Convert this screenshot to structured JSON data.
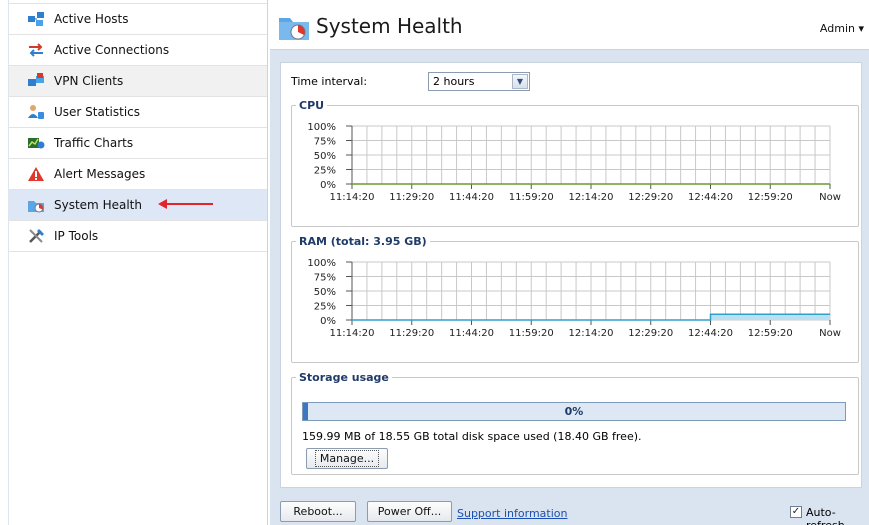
{
  "sidebar": {
    "items": [
      {
        "label": "Active Hosts",
        "icon": "network-hosts-icon"
      },
      {
        "label": "Active Connections",
        "icon": "connections-arrows-icon"
      },
      {
        "label": "VPN Clients",
        "icon": "vpn-clients-icon"
      },
      {
        "label": "User Statistics",
        "icon": "user-statistics-icon"
      },
      {
        "label": "Traffic Charts",
        "icon": "traffic-charts-icon"
      },
      {
        "label": "Alert Messages",
        "icon": "alert-warning-icon"
      },
      {
        "label": "System Health",
        "icon": "system-health-icon"
      },
      {
        "label": "IP Tools",
        "icon": "ip-tools-icon"
      }
    ],
    "selected_index": 6
  },
  "header": {
    "title": "System Health",
    "user_menu": "Admin ▾"
  },
  "controls": {
    "time_interval_label": "Time interval:",
    "time_interval_value": "2 hours"
  },
  "cpu": {
    "legend": "CPU",
    "chart_data": {
      "type": "line",
      "x_labels": [
        "11:14:20",
        "11:29:20",
        "11:44:20",
        "11:59:20",
        "12:14:20",
        "12:29:20",
        "12:44:20",
        "12:59:20",
        "Now"
      ],
      "y_labels": [
        "100%",
        "75%",
        "50%",
        "25%",
        "0%"
      ],
      "ylim": [
        0,
        100
      ],
      "series": [
        {
          "values": [
            0,
            0,
            0,
            0,
            0,
            0,
            0,
            0,
            0
          ],
          "color": "#6b9a2a"
        }
      ]
    }
  },
  "ram": {
    "legend": "RAM (total: 3.95 GB)",
    "chart_data": {
      "type": "area",
      "x_labels": [
        "11:14:20",
        "11:29:20",
        "11:44:20",
        "11:59:20",
        "12:14:20",
        "12:29:20",
        "12:44:20",
        "12:59:20",
        "Now"
      ],
      "y_labels": [
        "100%",
        "75%",
        "50%",
        "25%",
        "0%"
      ],
      "ylim": [
        0,
        100
      ],
      "series": [
        {
          "values": [
            0,
            0,
            0,
            0,
            0,
            0,
            10,
            10,
            10
          ],
          "color": "#2fa1c9"
        }
      ]
    }
  },
  "storage": {
    "legend": "Storage usage",
    "percent_label": "0%",
    "percent_value": 0.5,
    "usage_text": "159.99 MB of 18.55 GB total disk space used (18.40 GB free).",
    "manage_label": "Manage..."
  },
  "footer": {
    "reboot_label": "Reboot...",
    "poweroff_label": "Power Off...",
    "support_label": "Support information",
    "autorefresh_label": "Auto-refresh",
    "autorefresh_checked": true
  }
}
